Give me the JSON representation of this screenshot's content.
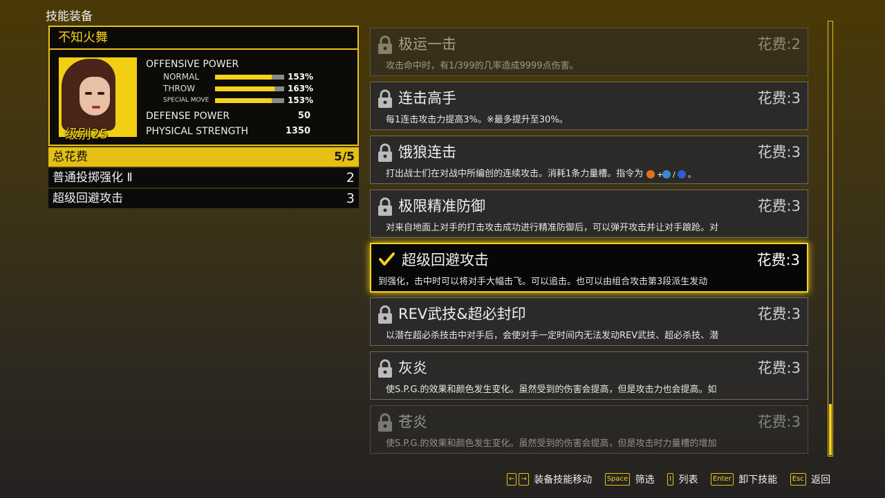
{
  "screen_title": "技能装备",
  "character": {
    "name": "不知火舞",
    "level": "级别25",
    "offensive_label": "OFFENSIVE POWER",
    "stats": [
      {
        "label": "NORMAL",
        "pct": "153%",
        "fill": 0.82
      },
      {
        "label": "THROW",
        "pct": "163%",
        "fill": 0.86
      },
      {
        "label": "SPECIAL MOVE",
        "pct": "153%",
        "fill": 0.82
      }
    ],
    "defense_label": "DEFENSE POWER",
    "defense_value": "50",
    "strength_label": "PHYSICAL STRENGTH",
    "strength_value": "1350"
  },
  "cost_summary": {
    "total_label": "总花费",
    "total_value": "5/5",
    "equipped": [
      {
        "name": "普通投掷强化 Ⅱ",
        "cost": "2"
      },
      {
        "name": "超级回避攻击",
        "cost": "3"
      }
    ]
  },
  "skills": [
    {
      "name": "极运一击",
      "cost": "花费:2",
      "desc": "攻击命中时，有1/399的几率造成9999点伤害。",
      "state": "locked",
      "faded": true
    },
    {
      "name": "连击高手",
      "cost": "花费:3",
      "desc": "每1连击攻击力提高3%。※最多提升至30%。",
      "state": "locked",
      "faded": false
    },
    {
      "name": "饿狼连击",
      "cost": "花费:3",
      "desc": "打出战士们在对战中所编创的连续攻击。消耗1条力量槽。指令为",
      "state": "locked",
      "faded": false
    },
    {
      "name": "极限精准防御",
      "cost": "花费:3",
      "desc": "对来自地面上对手的打击攻击成功进行精准防御后，可以弹开攻击并让对手踉跄。对",
      "state": "locked",
      "faded": false
    },
    {
      "name": "超级回避攻击",
      "cost": "花费:3",
      "desc": "到强化，击中时可以将对手大幅击飞。可以追击。也可以由组合攻击第3段派生发动",
      "state": "equipped",
      "faded": false
    },
    {
      "name": "REV武技&超必封印",
      "cost": "花费:3",
      "desc": "以潜在超必杀技击中对手后，会使对手一定时间内无法发动REV武技、超必杀技、潜",
      "state": "locked",
      "faded": false
    },
    {
      "name": "灰炎",
      "cost": "花费:3",
      "desc": "使S.P.G.的效果和颜色发生变化。虽然受到的伤害会提高，但是攻击力也会提高。如",
      "state": "locked",
      "faded": false
    },
    {
      "name": "苍炎",
      "cost": "花费:3",
      "desc": "使S.P.G.的效果和颜色发生变化。虽然受到的伤害会提高，但是攻击时力量槽的增加",
      "state": "locked",
      "faded": true
    }
  ],
  "footer": {
    "move": {
      "keys": [
        "←",
        "→"
      ],
      "label": "装备技能移动"
    },
    "filter": {
      "key": "Space",
      "label": "筛选"
    },
    "list": {
      "key": "I",
      "label": "列表"
    },
    "unequip": {
      "key": "Enter",
      "label": "卸下技能"
    },
    "back": {
      "key": "Esc",
      "label": "返回"
    }
  },
  "colors": {
    "accent": "#f5d21c",
    "panel": "#0c0b08"
  }
}
